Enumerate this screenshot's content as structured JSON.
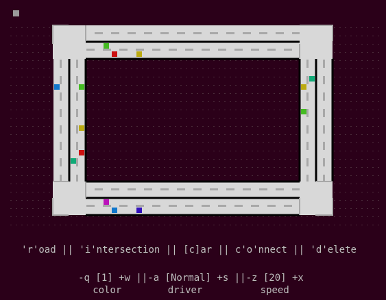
{
  "colors": {
    "background": "#2b0019",
    "dot": "#4a2a3a",
    "road": "#d8d8d8",
    "road_edge": "#000000",
    "lane_marking": "#a8a8a8",
    "intersection": "#d8d8d8",
    "text": "#bdbdbd",
    "cursor": "#9a9a9a"
  },
  "cars": [
    {
      "color": "#44bb22"
    },
    {
      "color": "#cc1111"
    },
    {
      "color": "#bbaa11"
    },
    {
      "color": "#1177cc"
    },
    {
      "color": "#44bb22"
    },
    {
      "color": "#bbaa11"
    },
    {
      "color": "#cc1111"
    },
    {
      "color": "#11aa77"
    },
    {
      "color": "#11aa77"
    },
    {
      "color": "#bbaa11"
    },
    {
      "color": "#44bb22"
    },
    {
      "color": "#bb11bb"
    },
    {
      "color": "#1177cc"
    },
    {
      "color": "#3311bb"
    }
  ],
  "help": {
    "commands": "'r'oad || 'i'ntersection || [c]ar || c'o'nnect || 'd'elete",
    "controls": "-q [1] +w ||-a [Normal] +s ||-z [20] +x",
    "labels": "color        driver          speed"
  }
}
